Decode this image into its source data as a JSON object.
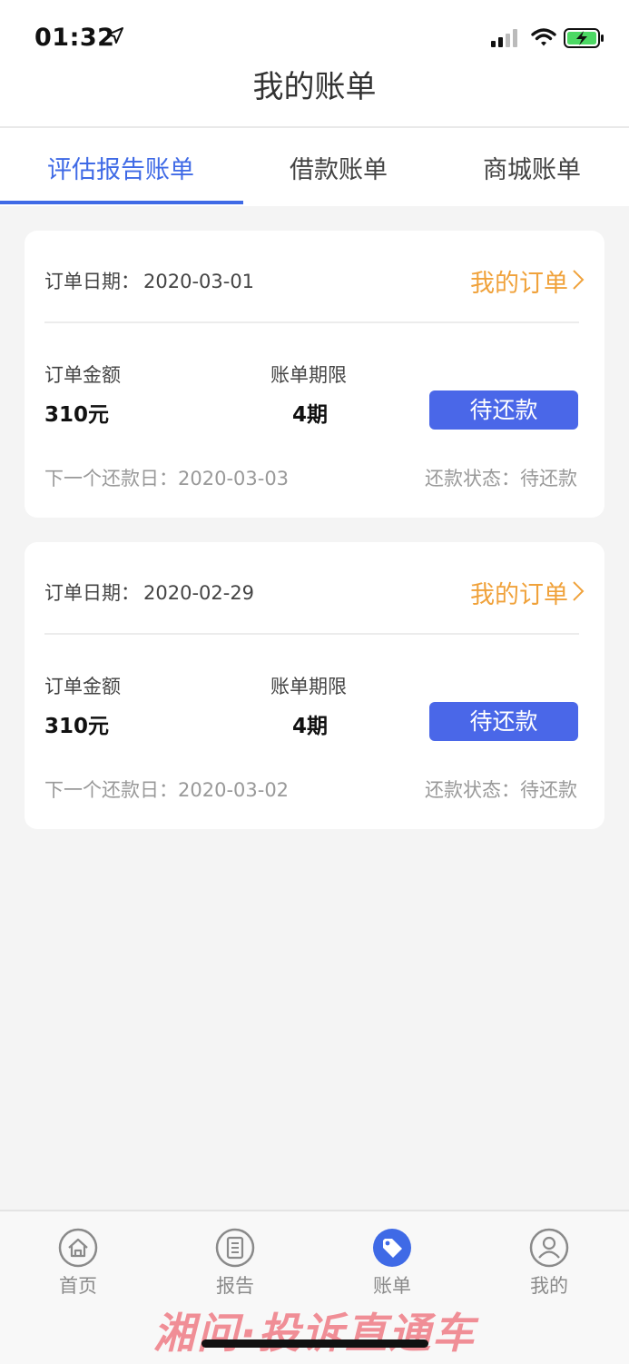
{
  "status_bar": {
    "time": "01:32"
  },
  "header": {
    "title": "我的账单"
  },
  "tabs": [
    {
      "label": "评估报告账单",
      "active": true
    },
    {
      "label": "借款账单",
      "active": false
    },
    {
      "label": "商城账单",
      "active": false
    }
  ],
  "bills": [
    {
      "order_date_label": "订单日期：",
      "order_date": "2020-03-01",
      "my_order_link": "我的订单",
      "amount_label": "订单金额",
      "amount": "310元",
      "term_label": "账单期限",
      "term": "4期",
      "button_label": "待还款",
      "next_date_label": "下一个还款日：",
      "next_date": "2020-03-03",
      "status_label": "还款状态：",
      "status": "待还款"
    },
    {
      "order_date_label": "订单日期：",
      "order_date": "2020-02-29",
      "my_order_link": "我的订单",
      "amount_label": "订单金额",
      "amount": "310元",
      "term_label": "账单期限",
      "term": "4期",
      "button_label": "待还款",
      "next_date_label": "下一个还款日：",
      "next_date": "2020-03-02",
      "status_label": "还款状态：",
      "status": "待还款"
    }
  ],
  "bottom_nav": [
    {
      "label": "首页",
      "icon": "home-icon",
      "active": false
    },
    {
      "label": "报告",
      "icon": "report-icon",
      "active": false
    },
    {
      "label": "账单",
      "icon": "tag-icon",
      "active": true
    },
    {
      "label": "我的",
      "icon": "user-icon",
      "active": false
    }
  ],
  "watermark": "湘问·投诉直通车",
  "colors": {
    "accent": "#3f6ae6",
    "button": "#4a67e8",
    "link_orange": "#f0a23b",
    "muted_text": "#999999",
    "background": "#f4f4f4"
  }
}
